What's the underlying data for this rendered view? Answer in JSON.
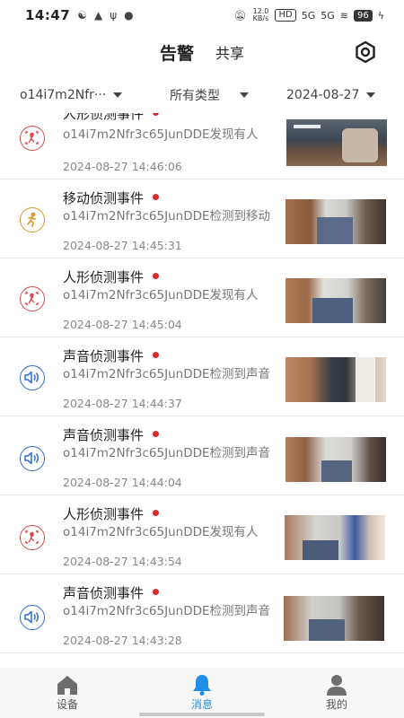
{
  "status": {
    "time": "14:47",
    "speed": "12.0 KB/s",
    "hd": "HD",
    "net1": "5G",
    "net2": "5G",
    "battery": "96"
  },
  "header": {
    "title": "告警",
    "share": "共享"
  },
  "filters": {
    "device": "o14i7m2Nfr···",
    "type": "所有类型",
    "date": "2024-08-27"
  },
  "events": [
    {
      "title": "人形侦测事件",
      "desc": "o14i7m2Nfr3c65JunDDE发现有人",
      "time": "2024-08-27 14:46:06",
      "icon": "person-detect-icon",
      "color": "#d94a4a"
    },
    {
      "title": "移动侦测事件",
      "desc": "o14i7m2Nfr3c65JunDDE检测到移动",
      "time": "2024-08-27 14:45:31",
      "icon": "motion-detect-icon",
      "color": "#d9962b"
    },
    {
      "title": "人形侦测事件",
      "desc": "o14i7m2Nfr3c65JunDDE发现有人",
      "time": "2024-08-27 14:45:04",
      "icon": "person-detect-icon",
      "color": "#d94a4a"
    },
    {
      "title": "声音侦测事件",
      "desc": "o14i7m2Nfr3c65JunDDE检测到声音",
      "time": "2024-08-27 14:44:37",
      "icon": "sound-detect-icon",
      "color": "#2e6fd1"
    },
    {
      "title": "声音侦测事件",
      "desc": "o14i7m2Nfr3c65JunDDE检测到声音",
      "time": "2024-08-27 14:44:04",
      "icon": "sound-detect-icon",
      "color": "#2e6fd1"
    },
    {
      "title": "人形侦测事件",
      "desc": "o14i7m2Nfr3c65JunDDE发现有人",
      "time": "2024-08-27 14:43:54",
      "icon": "person-detect-icon",
      "color": "#d94a4a"
    },
    {
      "title": "声音侦测事件",
      "desc": "o14i7m2Nfr3c65JunDDE检测到声音",
      "time": "2024-08-27 14:43:28",
      "icon": "sound-detect-icon",
      "color": "#2e6fd1"
    }
  ],
  "nav": [
    {
      "label": "设备",
      "icon": "home-icon"
    },
    {
      "label": "消息",
      "icon": "bell-icon",
      "active": true
    },
    {
      "label": "我的",
      "icon": "user-icon"
    }
  ],
  "accent": "#1f8ee8"
}
